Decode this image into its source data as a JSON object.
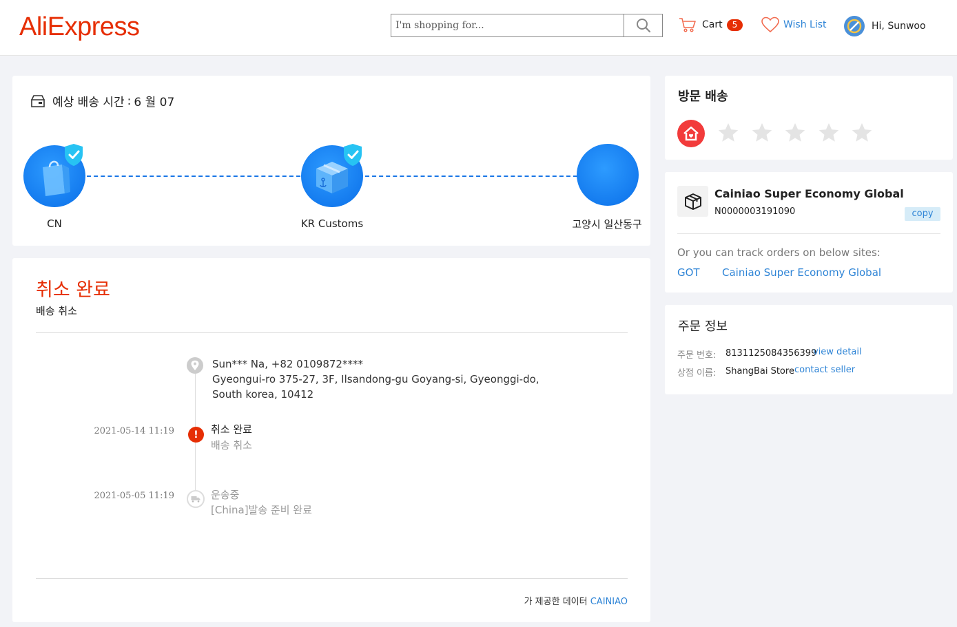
{
  "header": {
    "logo": "AliExpress",
    "search_placeholder": "I'm shopping for...",
    "cart_label": "Cart",
    "cart_count": "5",
    "wishlist_label": "Wish List",
    "greeting": "Hi, Sunwoo"
  },
  "tracking": {
    "eta_label": "예상 배송 시간",
    "eta_sep": ":",
    "eta_value": "6 월 07",
    "nodes": [
      "CN",
      "KR Customs",
      "고양시 일산동구"
    ]
  },
  "detail": {
    "status_title": "취소 완료",
    "status_sub": "배송 취소",
    "address_line1": "Sun*** Na,  +82 0109872****",
    "address_line2": "Gyeongui-ro 375-27, 3F,  Ilsandong-gu Goyang-si,  Gyeonggi-do,  South korea,  10412",
    "events": [
      {
        "time": "2021-05-14 11:19",
        "title": "취소 완료",
        "desc": "배송 취소"
      },
      {
        "time": "2021-05-05 11:19",
        "title": "운송중",
        "desc": "[China]발송 준비 완료"
      }
    ],
    "provider_prefix": "가 제공한 데이터",
    "provider_link": "CAINIAO"
  },
  "visit": {
    "title": "방문 배송",
    "rating": 0,
    "max_rating": 5
  },
  "carrier": {
    "name": "Cainiao Super Economy Global",
    "tracking_number": "N0000003191090",
    "copy_label": "copy",
    "track_note": "Or you can track orders on below sites:",
    "sites": [
      "GOT",
      "Cainiao Super Economy Global"
    ]
  },
  "order": {
    "title": "주문 정보",
    "number_label": "주문 번호:",
    "number_value": "8131125084356399",
    "view_detail": "view detail",
    "store_label": "상점 이름:",
    "store_value": "ShangBai Store",
    "contact_seller": "contact seller"
  },
  "colors": {
    "brand": "#e62e04",
    "link": "#2e84d6",
    "node_blue": "#0a6ee8",
    "shield": "#27c3f3"
  }
}
